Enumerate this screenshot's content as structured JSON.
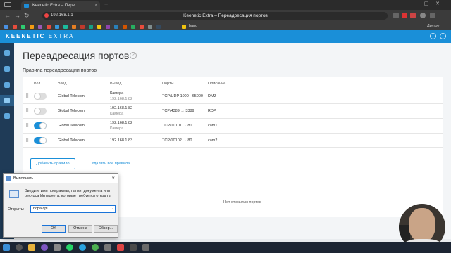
{
  "browser": {
    "tab_title": "Keenetic Extra – Пере...",
    "url": "192.168.1.1",
    "page_title": "Keenetic Extra – Переадресация портов",
    "bookmarks_folder": "band",
    "other_bookmarks": "Другое"
  },
  "header": {
    "logo_main": "KEENETIC",
    "logo_sub": "EXTRA"
  },
  "page": {
    "title": "Переадресация портов",
    "section_title": "Правила переадресации портов",
    "columns": [
      "Вкл",
      "Вход",
      "Выход",
      "Порты",
      "Описание"
    ],
    "rows": [
      {
        "enabled": false,
        "input": "Global Telecom",
        "output": "Камера",
        "output_sub": "192.168.1.82",
        "ports": "TCP/UDP 1000 - 65000",
        "description": "DMZ"
      },
      {
        "enabled": false,
        "input": "Global Telecom",
        "output": "192.168.1.82",
        "output_sub": "Камера",
        "ports": "TCP/4389 → 3389",
        "description": "RDP"
      },
      {
        "enabled": true,
        "input": "Global Telecom",
        "output": "192.168.1.82",
        "output_sub": "Камера",
        "ports": "TCP/10101 → 80",
        "description": "cam1"
      },
      {
        "enabled": true,
        "input": "Global Telecom",
        "output": "192.168.1.83",
        "output_sub": "",
        "ports": "TCP/10102 → 80",
        "description": "cam2"
      }
    ],
    "add_rule": "Добавить правило",
    "delete_all": "Удалить все правила",
    "no_open_ports": "Нет открытых портов"
  },
  "run_dialog": {
    "title": "Выполнить",
    "description": "Введите имя программы, папки, документа или ресурса Интернета, которые требуется открыть.",
    "open_label": "Открыть:",
    "input_value": "ncpa.cpl",
    "ok": "OK",
    "cancel": "Отмена",
    "browse": "Обзор..."
  },
  "colors": {
    "accent": "#1a8fd8",
    "sidebar": "#1f3b57"
  }
}
